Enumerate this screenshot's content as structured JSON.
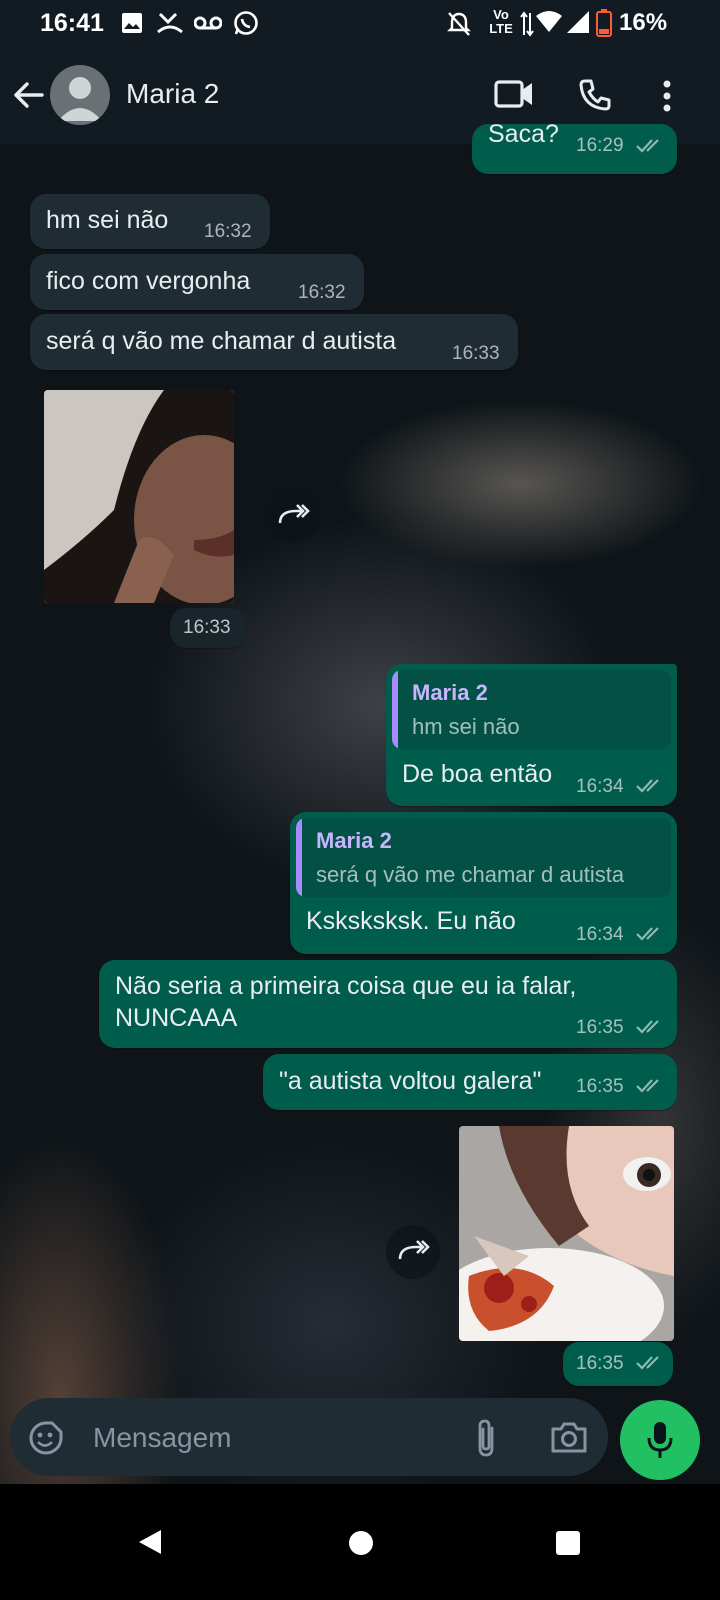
{
  "status_bar": {
    "time": "16:41",
    "network": "Vo LTE",
    "battery": "16%",
    "notification_icons": [
      "gallery-icon",
      "missed-call-icon",
      "voicemail-icon",
      "whatsapp-icon"
    ],
    "system_icons": [
      "mute-icon",
      "wifi-icon",
      "signal-icon",
      "battery-icon"
    ]
  },
  "header": {
    "contact_name": "Maria 2",
    "actions": [
      "video-call-icon",
      "voice-call-icon",
      "more-options-icon"
    ]
  },
  "messages": [
    {
      "direction": "out",
      "text": "Saca?",
      "time": "16:29",
      "read": true
    },
    {
      "direction": "in",
      "text": "hm sei não",
      "time": "16:32"
    },
    {
      "direction": "in",
      "text": "fico com vergonha",
      "time": "16:32"
    },
    {
      "direction": "in",
      "text": "será q vão me chamar d autista",
      "time": "16:33"
    },
    {
      "direction": "in",
      "type": "image",
      "time": "16:33"
    },
    {
      "direction": "out",
      "quote": {
        "author": "Maria 2",
        "text": "hm sei não"
      },
      "text": "De boa então",
      "time": "16:34",
      "read": true
    },
    {
      "direction": "out",
      "quote": {
        "author": "Maria 2",
        "text": "será q vão me chamar d autista"
      },
      "text": "Ksksksksk. Eu não",
      "time": "16:34",
      "read": true
    },
    {
      "direction": "out",
      "text_lines": [
        "Não seria a primeira coisa que eu ia falar,",
        "NUNCAAA"
      ],
      "time": "16:35",
      "read": true
    },
    {
      "direction": "out",
      "text": "\"a autista voltou galera\"",
      "time": "16:35",
      "read": true
    },
    {
      "direction": "out",
      "type": "image",
      "time": "16:35",
      "read": true
    }
  ],
  "composer": {
    "placeholder": "Mensagem",
    "icons": [
      "emoji-icon",
      "attach-icon",
      "camera-icon",
      "mic-icon"
    ]
  },
  "colors": {
    "incoming_bubble": "#202c33",
    "outgoing_bubble": "#005c4b",
    "accent_green": "#21c063",
    "read_ticks": "#8fb9b0",
    "quote_bar": "#a88cff"
  }
}
